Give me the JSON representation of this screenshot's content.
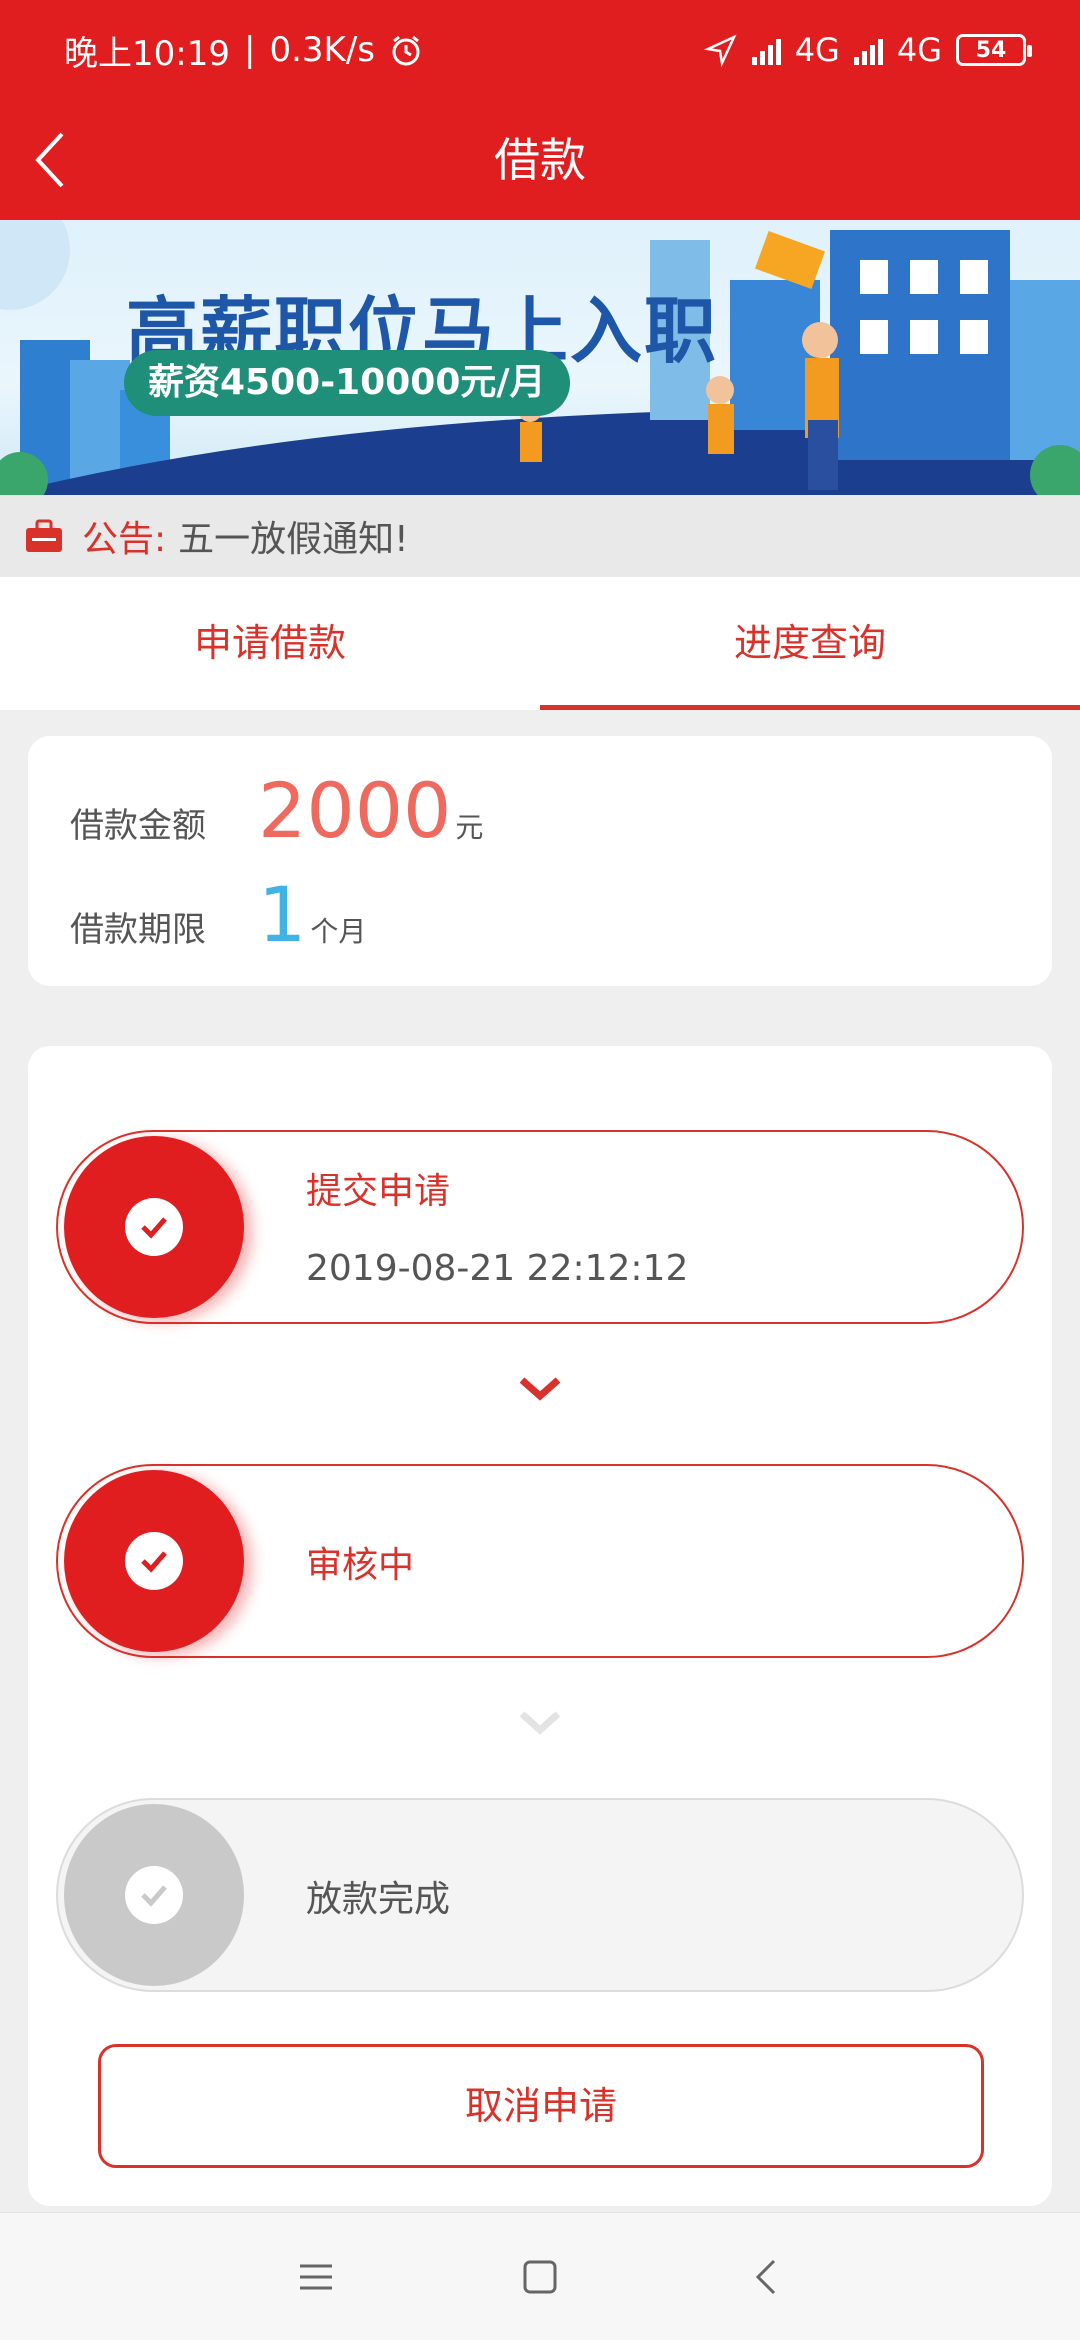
{
  "status_bar": {
    "time": "晚上10:19",
    "separator": "|",
    "speed": "0.3K/s",
    "network_1": "4G",
    "network_2": "4G",
    "battery": "54",
    "icons": [
      "alarm-icon",
      "location-icon",
      "signal-icon",
      "battery-icon"
    ]
  },
  "header": {
    "title": "借款",
    "icons": [
      "back-chevron-icon"
    ]
  },
  "banner": {
    "title": "高薪职位马上入职",
    "subtitle": "薪资4500-10000元/月"
  },
  "notice": {
    "label": "公告:",
    "text": "五一放假通知!",
    "icons": [
      "notice-bag-icon"
    ]
  },
  "tabs": [
    {
      "label": "申请借款",
      "active": false
    },
    {
      "label": "进度查询",
      "active": true
    }
  ],
  "loan": {
    "amount_label": "借款金额",
    "amount_value": "2000",
    "amount_unit": "元",
    "term_label": "借款期限",
    "term_value": "1",
    "term_unit": "个月"
  },
  "steps": [
    {
      "title": "提交申请",
      "time": "2019-08-21 22:12:12",
      "done": true
    },
    {
      "title": "审核中",
      "done": true
    },
    {
      "title": "放款完成",
      "done": false
    }
  ],
  "cancel_label": "取消申请",
  "colors": {
    "brand_red": "#e01d1f",
    "accent_red": "#d9322a",
    "amount": "#ef6a5e",
    "term": "#3fb3e6",
    "pending": "#c9c9c9"
  },
  "nav_icons": [
    "menu-icon",
    "home-icon",
    "back-icon"
  ]
}
